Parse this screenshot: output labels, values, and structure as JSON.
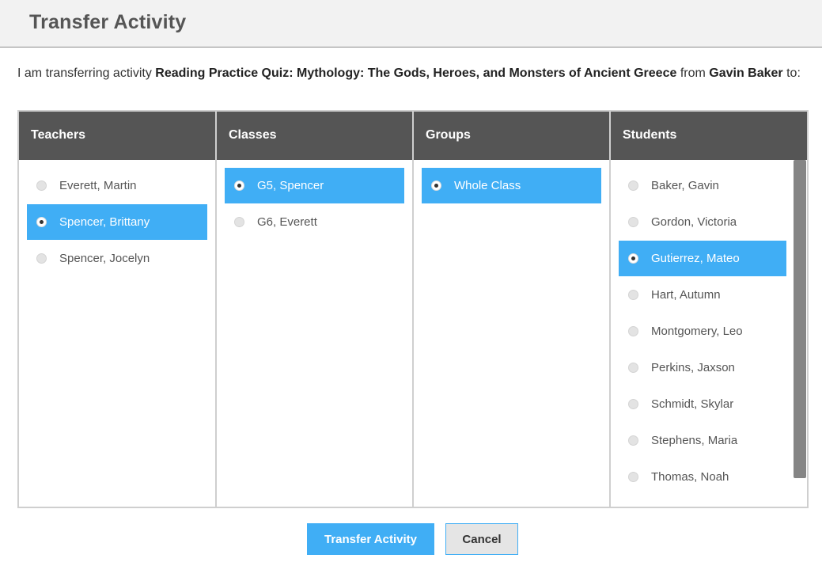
{
  "header": {
    "title": "Transfer Activity"
  },
  "intro": {
    "prefix": "I am transferring activity ",
    "activity": "Reading Practice Quiz: Mythology: The Gods, Heroes, and Monsters of Ancient Greece",
    "middle": " from ",
    "student": "Gavin Baker",
    "suffix": " to:"
  },
  "teachers": {
    "heading": "Teachers",
    "items": [
      {
        "label": "Everett, Martin",
        "selected": false
      },
      {
        "label": "Spencer, Brittany",
        "selected": true
      },
      {
        "label": "Spencer, Jocelyn",
        "selected": false
      }
    ]
  },
  "classes": {
    "heading": "Classes",
    "items": [
      {
        "label": "G5, Spencer",
        "selected": true
      },
      {
        "label": "G6, Everett",
        "selected": false
      }
    ]
  },
  "groups": {
    "heading": "Groups",
    "items": [
      {
        "label": "Whole Class",
        "selected": true
      }
    ]
  },
  "students": {
    "heading": "Students",
    "items": [
      {
        "label": "Baker, Gavin",
        "selected": false
      },
      {
        "label": "Gordon, Victoria",
        "selected": false
      },
      {
        "label": "Gutierrez, Mateo",
        "selected": true
      },
      {
        "label": "Hart, Autumn",
        "selected": false
      },
      {
        "label": "Montgomery, Leo",
        "selected": false
      },
      {
        "label": "Perkins, Jaxson",
        "selected": false
      },
      {
        "label": "Schmidt, Skylar",
        "selected": false
      },
      {
        "label": "Stephens, Maria",
        "selected": false
      },
      {
        "label": "Thomas, Noah",
        "selected": false
      }
    ]
  },
  "buttons": {
    "transfer_label": "Transfer Activity",
    "cancel_label": "Cancel"
  },
  "colors": {
    "accent": "#40aef5",
    "column_header": "#555555"
  }
}
